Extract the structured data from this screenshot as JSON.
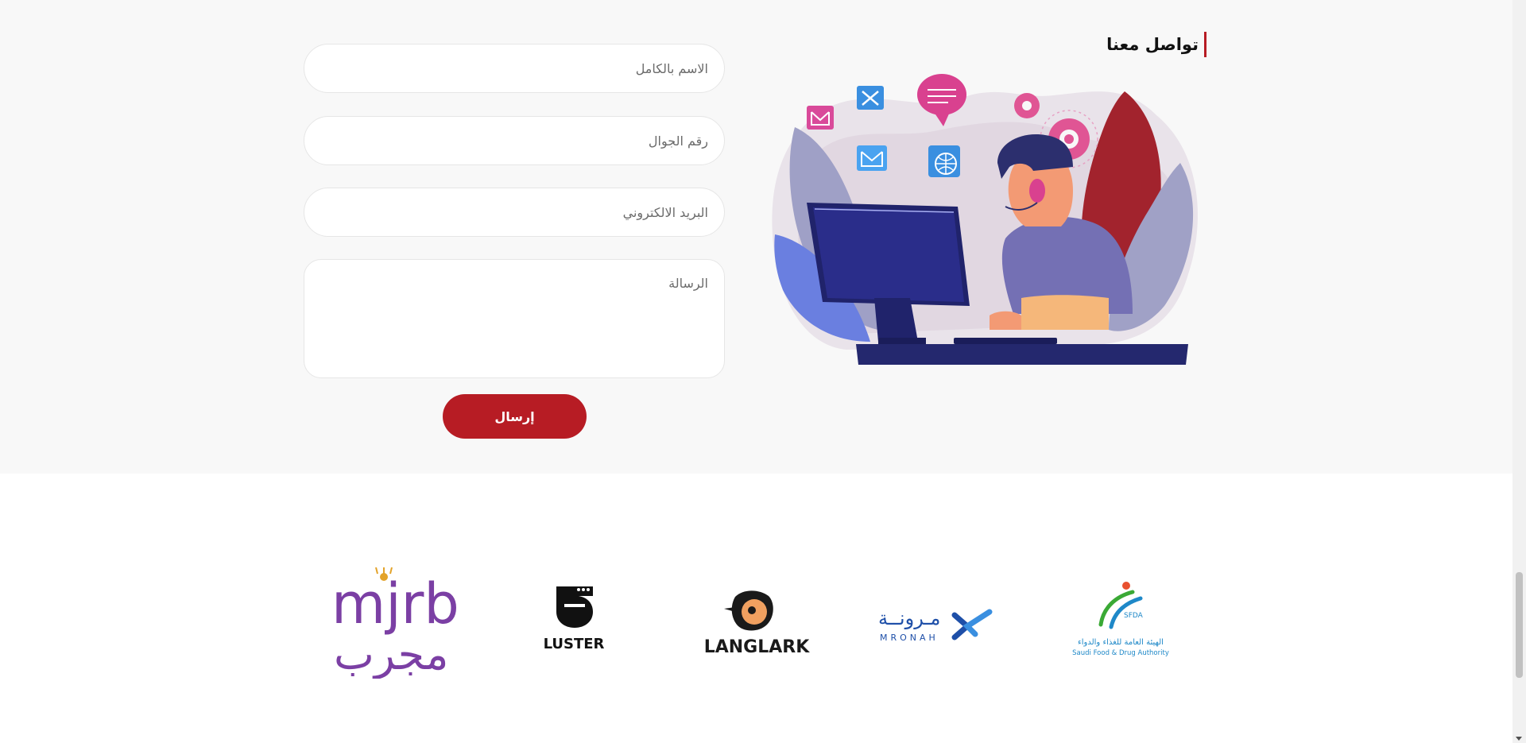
{
  "contact": {
    "title": "تواصل معنا",
    "fields": {
      "full_name_placeholder": "الاسم بالكامل",
      "mobile_placeholder": "رقم الجوال",
      "email_placeholder": "البريد الالكتروني",
      "message_placeholder": "الرسالة"
    },
    "submit_label": "إرسال"
  },
  "logos": {
    "mjrb": {
      "latin": "mjrb",
      "arabic": "مجرب"
    },
    "luster": {
      "text": "LUSTER"
    },
    "langlark": {
      "text": "LANGLARK"
    },
    "mronah": {
      "arabic": "مـرونــة",
      "latin": "MRONAH"
    },
    "sfda": {
      "badge": "SFDA",
      "arabic": "الهيئة العامة للغذاء والدواء",
      "english": "Saudi Food & Drug Authority"
    }
  },
  "icons": [
    "support-agent-illustration",
    "envelope-icon",
    "tools-icon",
    "chat-bubble-icon",
    "gear-icon",
    "globe-icon"
  ],
  "colors": {
    "accent": "#b71c24",
    "background": "#f8f8f8",
    "mjrb": "#7b3fa4",
    "mronah": "#1e4fa8",
    "sfda_green": "#3aa935",
    "sfda_blue": "#1e88c8"
  }
}
